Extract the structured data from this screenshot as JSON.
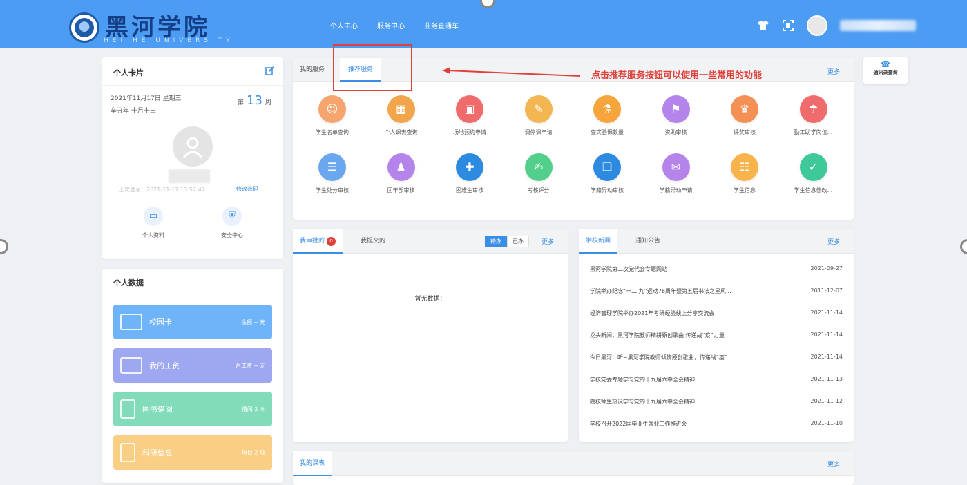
{
  "header": {
    "logo_title": "黑河学院",
    "logo_sub": "HEI HE UNIVERSITY",
    "nav": [
      "个人中心",
      "服务中心",
      "业务直通车"
    ],
    "icons": [
      "shirt-icon",
      "qr-scan-icon"
    ]
  },
  "personal_card": {
    "title": "个人卡片",
    "date_line1": "2021年11月17日 星期三",
    "date_line2": "辛丑年 十月十三",
    "week_prefix": "第",
    "week_num": "13",
    "week_suffix": "周",
    "login_time": "上次登录：2021-11-17 13:57:47",
    "change_pwd": "修改密码",
    "quick": [
      {
        "label": "个人资料",
        "icon": "id-card-icon"
      },
      {
        "label": "安全中心",
        "icon": "shield-icon"
      }
    ]
  },
  "personal_data": {
    "title": "个人数据",
    "items": [
      {
        "label": "校园卡",
        "value": "余额 -- 元",
        "color": "#6fb4f8",
        "icon": "card-icon"
      },
      {
        "label": "我的工资",
        "value": "月工资 -- 元",
        "color": "#9ea8f0",
        "icon": "wallet-icon"
      },
      {
        "label": "图书借阅",
        "value": "借阅 2 本",
        "color": "#83dcb9",
        "icon": "book-icon"
      },
      {
        "label": "科研信息",
        "value": "项目 2 项",
        "color": "#f8cf84",
        "icon": "research-icon"
      }
    ]
  },
  "services": {
    "tabs": [
      "我的服务",
      "推荐服务"
    ],
    "more": "更多",
    "items": [
      {
        "label": "学生名单查询",
        "color": "#f6a56e",
        "glyph": "☺"
      },
      {
        "label": "个人课表查询",
        "color": "#f2a54a",
        "glyph": "▦"
      },
      {
        "label": "场地预约申请",
        "color": "#f06b6b",
        "glyph": "▣"
      },
      {
        "label": "调停课申请",
        "color": "#f4b553",
        "glyph": "✎"
      },
      {
        "label": "查实验课数量",
        "color": "#f6a53d",
        "glyph": "⚗"
      },
      {
        "label": "资助审核",
        "color": "#b584ea",
        "glyph": "⚑"
      },
      {
        "label": "评奖审核",
        "color": "#f59055",
        "glyph": "♛"
      },
      {
        "label": "勤工助学岗位...",
        "color": "#f06b6b",
        "glyph": "☂"
      },
      {
        "label": "学生处分审核",
        "color": "#6aa7ee",
        "glyph": "☰"
      },
      {
        "label": "团干部审核",
        "color": "#b584ea",
        "glyph": "♟"
      },
      {
        "label": "困难生审核",
        "color": "#2c8ae0",
        "glyph": "✚"
      },
      {
        "label": "考核评分",
        "color": "#52cf8a",
        "glyph": "✍"
      },
      {
        "label": "学籍异动审核",
        "color": "#2c8ae0",
        "glyph": "❏"
      },
      {
        "label": "学籍异动申请",
        "color": "#b584ea",
        "glyph": "✉"
      },
      {
        "label": "学生信息",
        "color": "#f8b34d",
        "glyph": "☷"
      },
      {
        "label": "学生信息修改...",
        "color": "#3fc89a",
        "glyph": "✓"
      }
    ]
  },
  "annotation": "点击推荐服务按钮可以使用一些常用的功能",
  "contact": {
    "label": "通讯录查询"
  },
  "process": {
    "tabs": [
      "我审批的",
      "我提交的"
    ],
    "badge": "0",
    "toggle": [
      "待办",
      "已办"
    ],
    "more": "更多",
    "empty": "暂无数据！"
  },
  "news": {
    "tabs": [
      "学校新闻",
      "通知公告"
    ],
    "more": "更多",
    "rows": [
      {
        "title": "黑河学院第二次党代会专题网站",
        "date": "2021-09-27"
      },
      {
        "title": "学院举办纪念“一二·九”运动76周年暨第五届书法之星风...",
        "date": "2011-12-07"
      },
      {
        "title": "经济管理学院举办2021年考研经验线上分享交流会",
        "date": "2021-11-14"
      },
      {
        "title": "龙头新闻：黑河学院教师精耕原创歌曲 传递战“疫”力量",
        "date": "2021-11-14"
      },
      {
        "title": "今日黑河：听~黑河学院教师倾情原创歌曲，传递战“疫”...",
        "date": "2021-11-14"
      },
      {
        "title": "学校党委专题学习党的十九届六中全会精神",
        "date": "2021-11-13"
      },
      {
        "title": "院校师生热议学习党的十九届六中全会精神",
        "date": "2021-11-12"
      },
      {
        "title": "学校召开2022届毕业生就业工作推进会",
        "date": "2021-11-10"
      }
    ]
  },
  "courses": {
    "tab": "我的课表",
    "more": "更多"
  }
}
